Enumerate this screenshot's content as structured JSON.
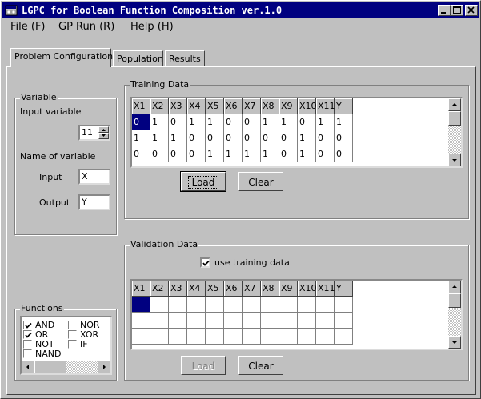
{
  "window": {
    "title": "LGPC for Boolean Function Composition ver.1.0"
  },
  "menu": [
    {
      "label": "File (F)"
    },
    {
      "label": "GP Run (R)"
    },
    {
      "label": "Help (H)"
    }
  ],
  "tabs": [
    {
      "label": "Problem Configuration",
      "active": true
    },
    {
      "label": "Population",
      "active": false
    },
    {
      "label": "Results",
      "active": false
    }
  ],
  "variable": {
    "group_label": "Variable",
    "input_variable_label": "Input variable",
    "input_variable_value": "11",
    "name_of_variable_label": "Name of variable",
    "input_label": "Input",
    "input_value": "X",
    "output_label": "Output",
    "output_value": "Y"
  },
  "training": {
    "group_label": "Training Data",
    "columns": [
      "X1",
      "X2",
      "X3",
      "X4",
      "X5",
      "X6",
      "X7",
      "X8",
      "X9",
      "X10",
      "X11",
      "Y"
    ],
    "rows": [
      [
        "0",
        "1",
        "0",
        "1",
        "1",
        "0",
        "0",
        "1",
        "1",
        "0",
        "1",
        "1"
      ],
      [
        "1",
        "1",
        "1",
        "0",
        "0",
        "0",
        "0",
        "0",
        "0",
        "1",
        "0",
        "0"
      ],
      [
        "0",
        "0",
        "0",
        "0",
        "1",
        "1",
        "1",
        "1",
        "0",
        "1",
        "0",
        "0"
      ]
    ],
    "load_label": "Load",
    "clear_label": "Clear"
  },
  "validation": {
    "group_label": "Validation Data",
    "use_training_label": "use training data",
    "use_training_checked": true,
    "columns": [
      "X1",
      "X2",
      "X3",
      "X4",
      "X5",
      "X6",
      "X7",
      "X8",
      "X9",
      "X10",
      "X11",
      "Y"
    ],
    "load_label": "Load",
    "clear_label": "Clear"
  },
  "functions": {
    "group_label": "Functions",
    "items": [
      {
        "label": "AND",
        "checked": true
      },
      {
        "label": "NOR",
        "checked": false
      },
      {
        "label": "OR",
        "checked": true
      },
      {
        "label": "XOR",
        "checked": false
      },
      {
        "label": "NOT",
        "checked": false
      },
      {
        "label": "IF",
        "checked": false
      },
      {
        "label": "NAND",
        "checked": false
      }
    ]
  }
}
